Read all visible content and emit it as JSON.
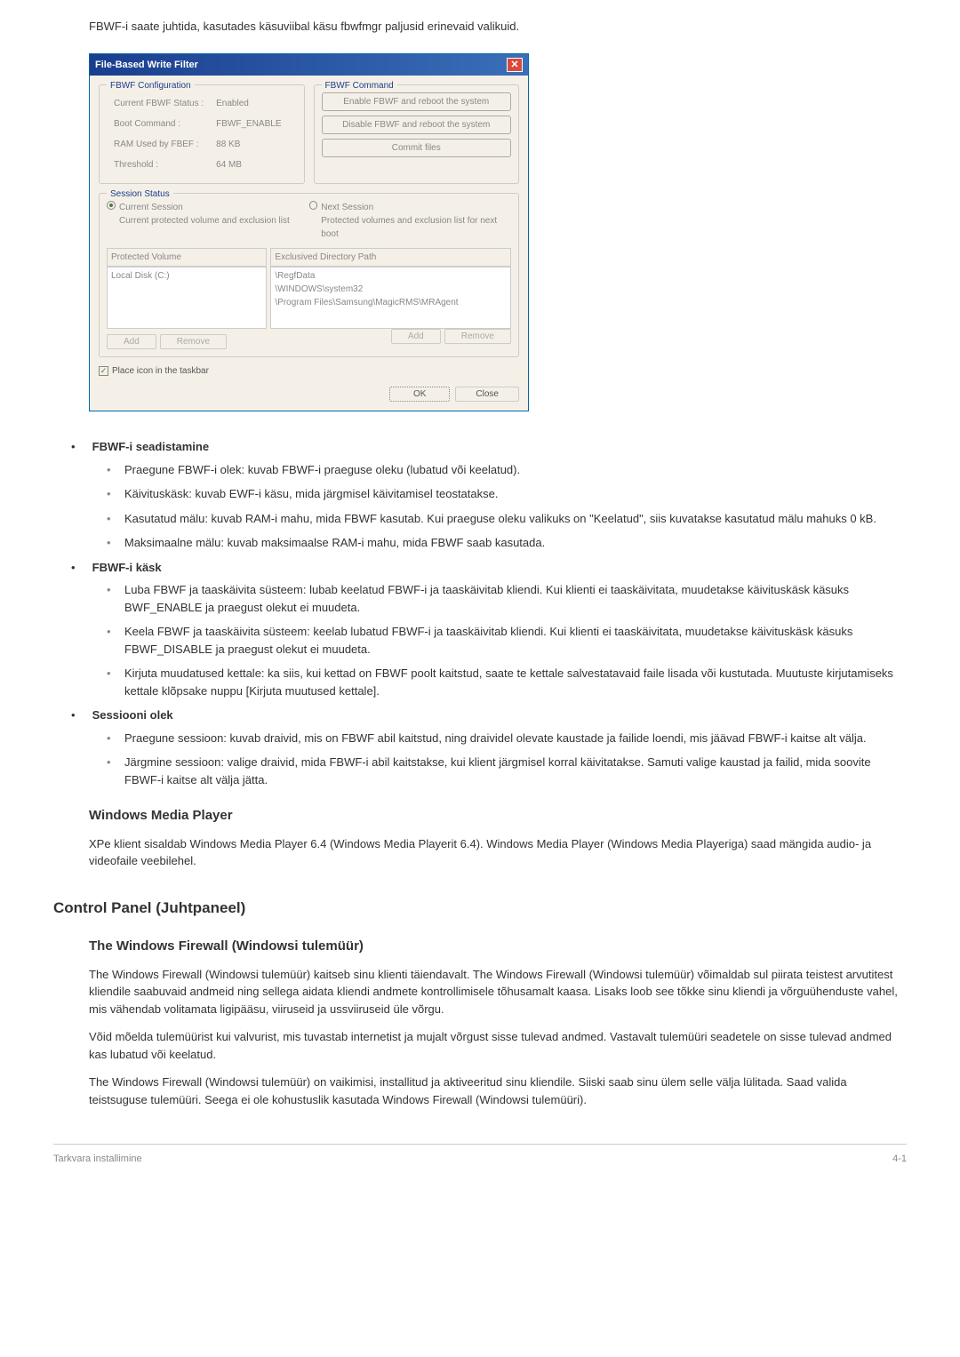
{
  "intro": "FBWF-i saate juhtida, kasutades käsuviibal käsu fbwfmgr paljusid erinevaid valikuid.",
  "dialog": {
    "title": "File-Based Write Filter",
    "close": "✕",
    "config": {
      "legend": "FBWF Configuration",
      "status_label": "Current FBWF Status :",
      "status_value": "Enabled",
      "boot_label": "Boot Command :",
      "boot_value": "FBWF_ENABLE",
      "ram_label": "RAM Used by FBEF :",
      "ram_value": "88 KB",
      "threshold_label": "Threshold :",
      "threshold_value": "64 MB"
    },
    "command": {
      "legend": "FBWF Command",
      "btn1": "Enable FBWF and reboot the system",
      "btn2": "Disable FBWF and reboot the system",
      "btn3": "Commit files"
    },
    "session": {
      "legend": "Session Status",
      "radio1": "Current Session",
      "radio1_sub": "Current  protected volume and exclusion list",
      "radio2": "Next Session",
      "radio2_sub": "Protected volumes and exclusion list for next boot",
      "col1_header": "Protected Volume",
      "col1_item": "Local Disk (C:)",
      "col2_header": "Exclusived Directory Path",
      "col2_item1": "\\RegfData",
      "col2_item2": "\\WINDOWS\\system32",
      "col2_item3": "\\Program Files\\Samsung\\MagicRMS\\MRAgent",
      "add": "Add",
      "remove": "Remove"
    },
    "taskbar_label": "Place icon in the taskbar",
    "ok": "OK",
    "close_btn": "Close"
  },
  "list": {
    "h1": "FBWF-i seadistamine",
    "h1_items": [
      "Praegune FBWF-i olek: kuvab FBWF-i praeguse oleku (lubatud või keelatud).",
      "Käivituskäsk: kuvab EWF-i käsu, mida järgmisel käivitamisel teostatakse.",
      "Kasutatud mälu: kuvab RAM-i mahu, mida FBWF kasutab. Kui praeguse oleku valikuks on \"Keelatud\", siis kuvatakse kasutatud mälu mahuks 0 kB.",
      "Maksimaalne mälu: kuvab maksimaalse RAM-i mahu, mida FBWF saab kasutada."
    ],
    "h2": "FBWF-i käsk",
    "h2_items": [
      "Luba FBWF ja taaskäivita süsteem: lubab keelatud FBWF-i ja taaskäivitab kliendi. Kui klienti ei taaskäivitata, muudetakse käivituskäsk käsuks BWF_ENABLE ja praegust olekut ei muudeta.",
      "Keela FBWF ja taaskäivita süsteem: keelab lubatud FBWF-i ja taaskäivitab kliendi. Kui klienti ei taaskäivitata, muudetakse käivituskäsk käsuks FBWF_DISABLE ja praegust olekut ei muudeta.",
      "Kirjuta muudatused kettale: ka siis, kui kettad on FBWF poolt kaitstud, saate te kettale salvestatavaid faile lisada või kustutada. Muutuste kirjutamiseks kettale klõpsake nuppu [Kirjuta muutused kettale]."
    ],
    "h3": "Sessiooni olek",
    "h3_items": [
      "Praegune sessioon: kuvab draivid, mis on FBWF abil kaitstud, ning draividel olevate kaustade ja failide loendi, mis jäävad FBWF-i kaitse alt välja.",
      "Järgmine sessioon: valige draivid, mida FBWF-i abil kaitstakse, kui klient järgmisel korral käivitatakse. Samuti valige kaustad ja failid, mida soovite FBWF-i kaitse alt välja jätta."
    ]
  },
  "wmp": {
    "heading": "Windows Media Player",
    "text": "XPe klient sisaldab Windows Media Player 6.4 (Windows Media Playerit 6.4). Windows Media Player (Windows Media Playeriga) saad mängida audio- ja videofaile veebilehel."
  },
  "cp": {
    "heading": "Control Panel (Juhtpaneel)",
    "fw_heading": "The Windows Firewall (Windowsi tulemüür)",
    "p1": "The Windows Firewall (Windowsi tulemüür) kaitseb sinu klienti täiendavalt. The Windows Firewall (Windowsi tulemüür) võimaldab sul piirata teistest arvutitest kliendile saabuvaid andmeid ning sellega aidata kliendi andmete kontrollimisele tõhusamalt kaasa. Lisaks loob see tõkke sinu kliendi ja võrguühenduste vahel, mis vähendab volitamata ligipääsu, viiruseid ja ussviiruseid üle võrgu.",
    "p2": "Võid mõelda tulemüürist kui valvurist, mis tuvastab internetist ja mujalt võrgust sisse tulevad andmed. Vastavalt tulemüüri seadetele on sisse tulevad andmed kas lubatud või keelatud.",
    "p3": "The Windows Firewall (Windowsi tulemüür) on vaikimisi, installitud ja aktiveeritud sinu kliendile. Siiski saab sinu ülem selle välja lülitada. Saad valida teistsuguse tulemüüri. Seega ei ole kohustuslik kasutada Windows Firewall (Windowsi tulemüüri)."
  },
  "footer": {
    "left": "Tarkvara installimine",
    "right": "4-1"
  }
}
